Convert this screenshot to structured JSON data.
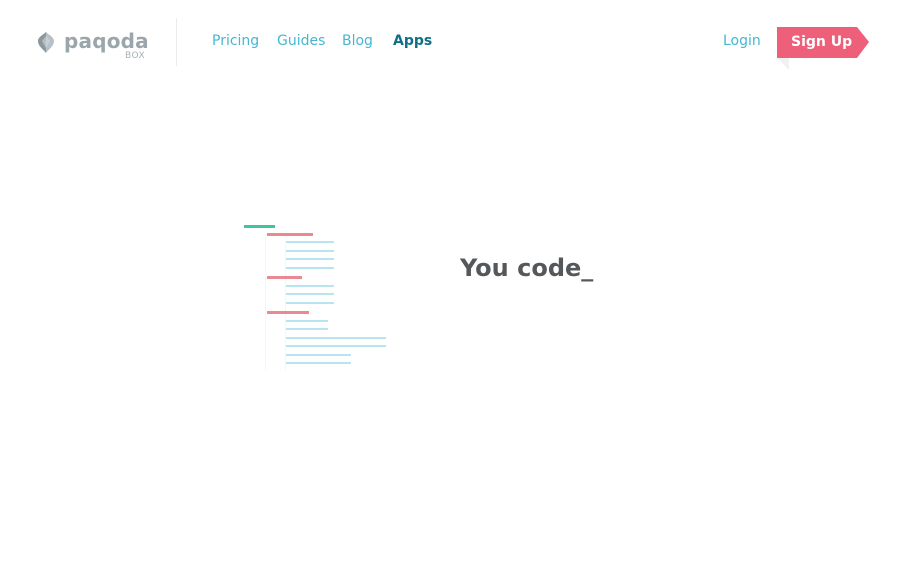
{
  "header": {
    "logo": {
      "word": "paqoda",
      "sub": "BOX",
      "icon": "pagoda-gem-icon"
    },
    "nav": [
      {
        "label": "Pricing",
        "active": false
      },
      {
        "label": "Guides",
        "active": false
      },
      {
        "label": "Blog",
        "active": false
      },
      {
        "label": "Apps",
        "active": true
      }
    ],
    "login_label": "Login",
    "signup_label": "Sign Up"
  },
  "hero": {
    "headline": "You code_"
  },
  "colors": {
    "nav_link": "#46b6d2",
    "nav_active": "#0f6f87",
    "signup_bg": "#ee5f7a",
    "code_green": "#3cc5a3",
    "code_red": "#ea8991",
    "code_blue": "#b6e5ef",
    "headline": "#55585b"
  }
}
